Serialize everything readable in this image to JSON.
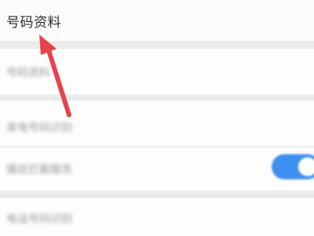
{
  "header": {
    "title": "号码资料"
  },
  "rows": [
    {
      "label": "号码资料"
    },
    {
      "label": "来电号码识别"
    },
    {
      "label": "骚扰拦截服务"
    },
    {
      "label": "电话号码识别"
    }
  ],
  "toggle": {
    "state": "on",
    "color": "#3d8ff0"
  },
  "annotation": {
    "arrow_color": "#e8434a",
    "icon": "arrow-annotation-icon"
  }
}
